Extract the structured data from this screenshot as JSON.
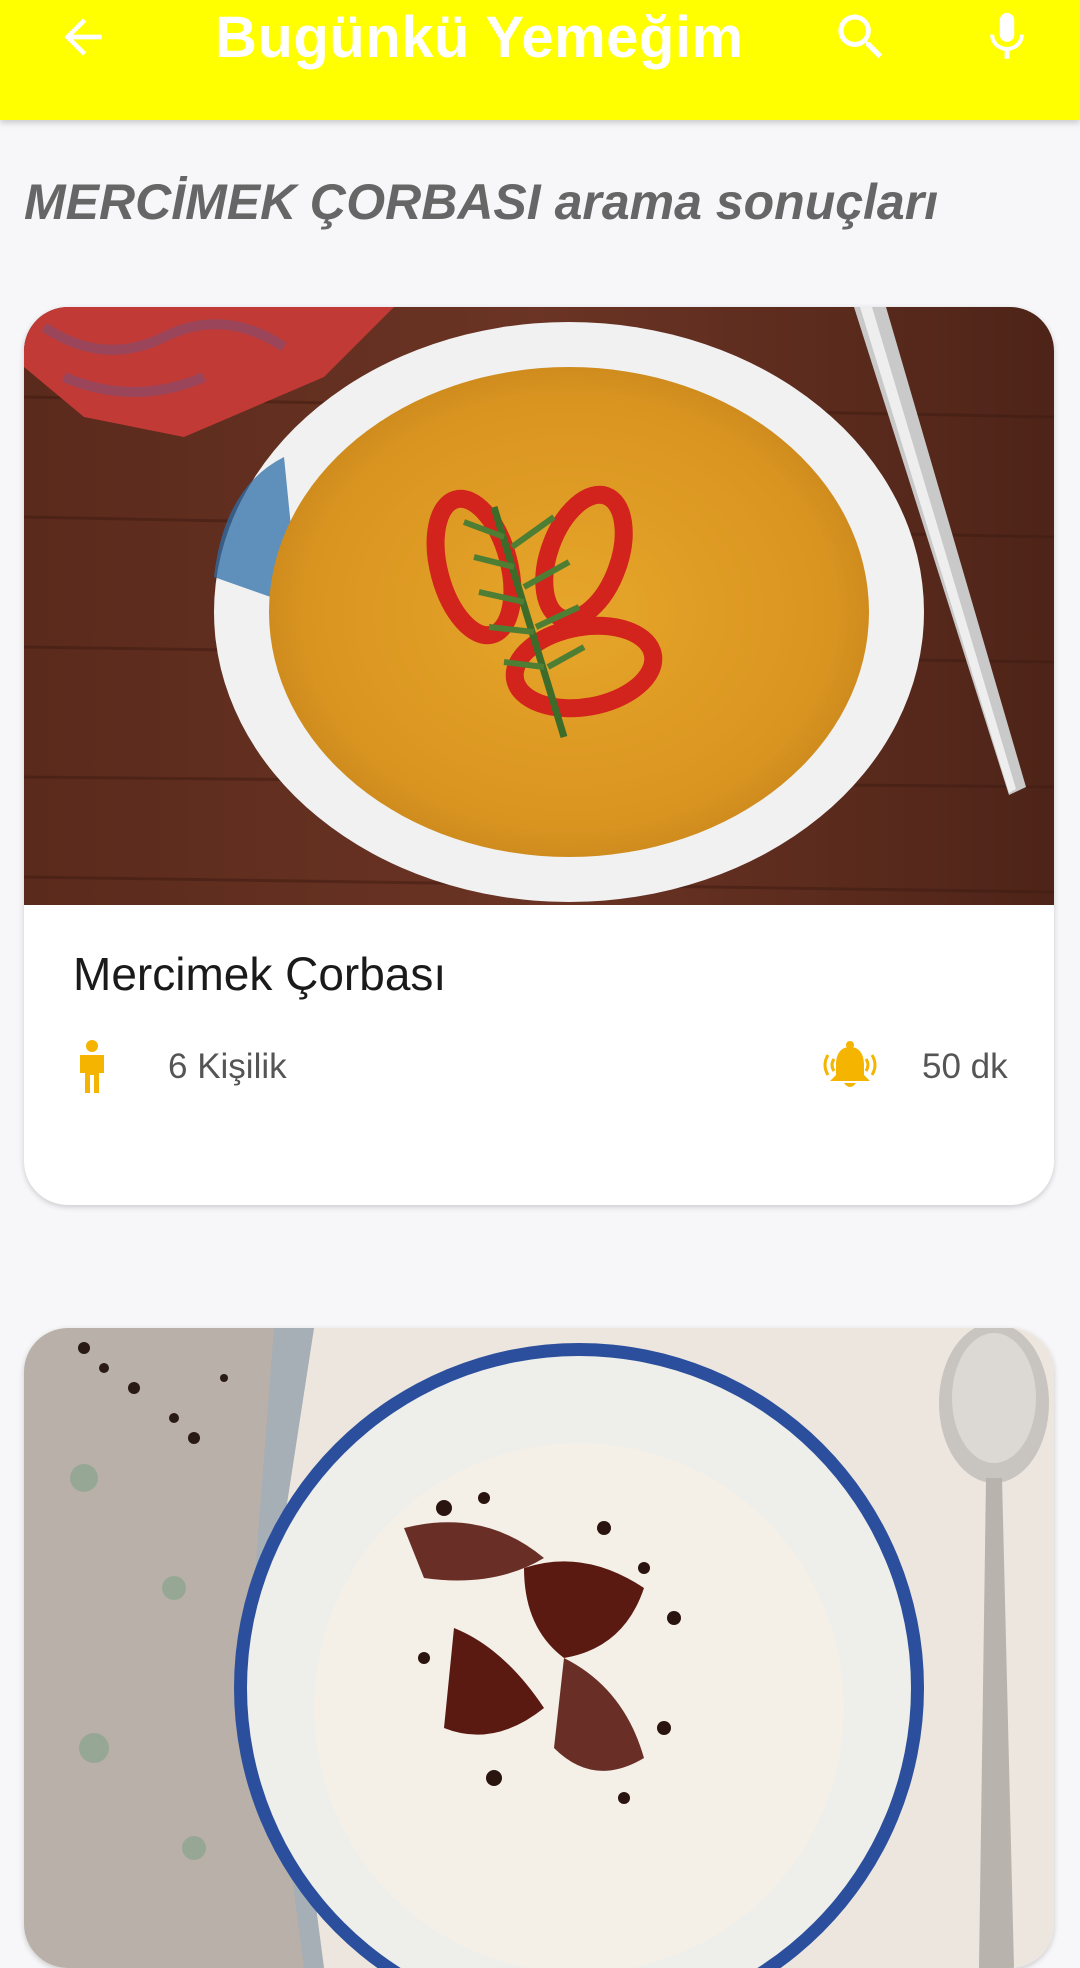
{
  "app_bar": {
    "title": "Bugünkü Yemeğim",
    "background_color": "#ffff00",
    "back_icon": "arrow-left-icon",
    "search_icon": "search-icon",
    "mic_icon": "microphone-icon"
  },
  "results": {
    "heading": "MERCİMEK ÇORBASI arama sonuçları"
  },
  "recipes": [
    {
      "title": "Mercimek Çorbası",
      "servings": "6 Kişilik",
      "servings_icon": "person-icon",
      "time": "50 dk",
      "time_icon": "bell-icon",
      "image": "lentil-soup-photo"
    },
    {
      "image": "yogurt-soup-photo"
    }
  ],
  "colors": {
    "accent": "#ffff00",
    "icon_orange": "#f5b400",
    "heading_gray": "#666666"
  }
}
